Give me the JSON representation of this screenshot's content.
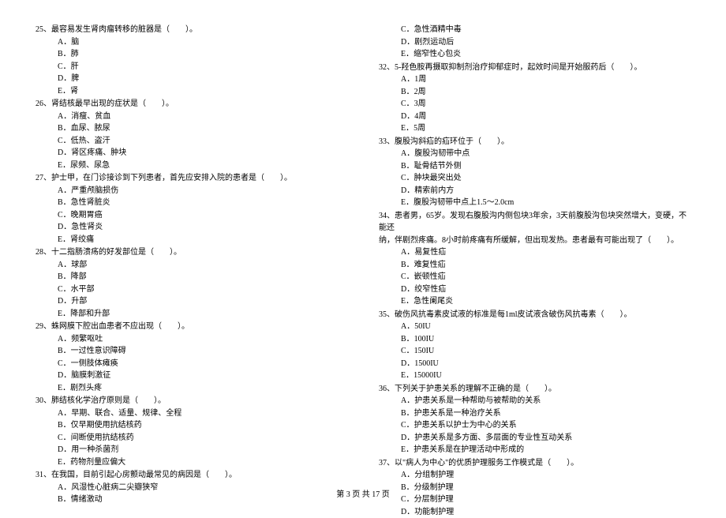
{
  "left": {
    "q25": {
      "stem": "25、最容易发生肾肉瘤转移的脏器是（　　）。",
      "a": "A．脑",
      "b": "B．肺",
      "c": "C．肝",
      "d": "D．脾",
      "e": "E．肾"
    },
    "q26": {
      "stem": "26、肾结核最早出现的症状是（　　）。",
      "a": "A．消瘦、贫血",
      "b": "B．血尿、脓尿",
      "c": "C．低热、盗汗",
      "d": "D．肾区疼痛、肿块",
      "e": "E．尿频、尿急"
    },
    "q27": {
      "stem": "27、护士甲，在门诊接诊到下列患者，首先应安排入院的患者是（　　）。",
      "a": "A．严重颅脑损伤",
      "b": "B．急性肾脏炎",
      "c": "C．晚期胃癌",
      "d": "D．急性肾炎",
      "e": "E．肾绞痛"
    },
    "q28": {
      "stem": "28、十二指肠溃疡的好发部位是（　　）。",
      "a": "A．球部",
      "b": "B．降部",
      "c": "C．水平部",
      "d": "D．升部",
      "e": "E．降部和升部"
    },
    "q29": {
      "stem": "29、蛛网膜下腔出血患者不应出现（　　）。",
      "a": "A．频繁呕吐",
      "b": "B．一过性意识障碍",
      "c": "C．一侧肢体瘫痪",
      "d": "D．脑膜刺激征",
      "e": "E．剧烈头疼"
    },
    "q30": {
      "stem": "30、肺结核化学治疗原则是（　　）。",
      "a": "A．早期、联合、适量、规律、全程",
      "b": "B．仅早期使用抗结核药",
      "c": "C．间断使用抗结核药",
      "d": "D．用一种杀菌剂",
      "e": "E．药物剂量应偏大"
    },
    "q31": {
      "stem": "31、在我国，目前引起心房颤动最常见的病因是（　　）。",
      "a": "A．风湿性心脏病二尖瓣狭窄",
      "b": "B．情绪激动"
    }
  },
  "right": {
    "q31c": {
      "c": "C．急性酒精中毒",
      "d": "D．剧烈运动后",
      "e": "E．缩窄性心包炎"
    },
    "q32": {
      "stem": "32、5-羟色胺再摄取抑制剂治疗抑郁症时，起效时间是开始服药后（　　）。",
      "a": "A．1周",
      "b": "B．2周",
      "c": "C．3周",
      "d": "D．4周",
      "e": "E．5周"
    },
    "q33": {
      "stem": "33、腹股沟斜疝的疝环位于（　　）。",
      "a": "A．腹股沟韧带中点",
      "b": "B．耻骨结节外侧",
      "c": "C．肿块最突出处",
      "d": "D．精索前内方",
      "e": "E．腹股沟韧带中点上1.5～2.0cm"
    },
    "q34": {
      "stem1": "34、患者男，65岁。发现右腹股沟内侧包块3年余，3天前腹股沟包块突然增大，变硬，不能还",
      "stem2": "纳，伴剧烈疼痛。8小时前疼痛有所缓解，但出现发热。患者最有可能出现了（　　）。",
      "a": "A．易复性疝",
      "b": "B．难复性疝",
      "c": "C．嵌顿性疝",
      "d": "D．绞窄性疝",
      "e": "E．急性阑尾炎"
    },
    "q35": {
      "stem": "35、破伤风抗毒素皮试液的标准是每1ml皮试液含破伤风抗毒素（　　）。",
      "a": "A．50IU",
      "b": "B．100IU",
      "c": "C．150IU",
      "d": "D．1500IU",
      "e": "E．15000IU"
    },
    "q36": {
      "stem": "36、下列关于护患关系的理解不正确的是（　　）。",
      "a": "A．护患关系是一种帮助与被帮助的关系",
      "b": "B．护患关系是一种治疗关系",
      "c": "C．护患关系以护士为中心的关系",
      "d": "D．护患关系是多方面、多层面的专业性互动关系",
      "e": "E．护患关系是在护理活动中形成的"
    },
    "q37": {
      "stem": "37、以\"病人为中心\"的优质护理服务工作模式是（　　）。",
      "a": "A．分组制护理",
      "b": "B．分级制护理",
      "c": "C．分层制护理",
      "d": "D．功能制护理"
    }
  },
  "footer": "第 3 页 共 17 页"
}
